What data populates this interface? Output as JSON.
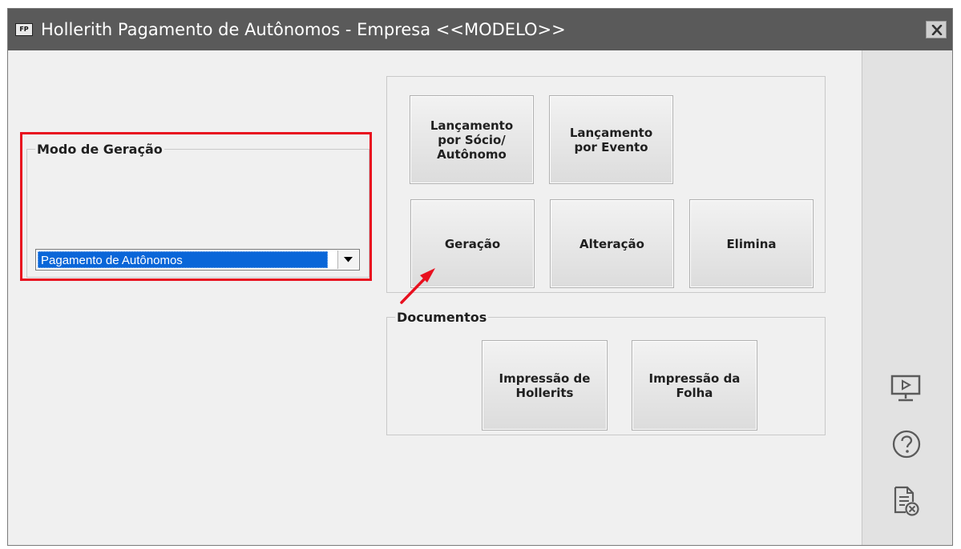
{
  "window": {
    "title": "Hollerith Pagamento de Autônomos - Empresa <<MODELO>>",
    "app_icon_label": "FP"
  },
  "modo": {
    "legend": "Modo de Geração",
    "selected": "Pagamento de Autônomos"
  },
  "actions": {
    "lanc_socio": "Lançamento\npor Sócio/\nAutônomo",
    "lanc_evento": "Lançamento\npor Evento",
    "geracao": "Geração",
    "alteracao": "Alteração",
    "elimina": "Elimina"
  },
  "documentos": {
    "legend": "Documentos",
    "imp_hollerits": "Impressão de\nHollerits",
    "imp_folha": "Impressão da\nFolha"
  },
  "colors": {
    "titlebar": "#5a5a5a",
    "highlight": "#e8101f",
    "selection": "#0a66d8"
  },
  "icons": [
    "presentation-icon",
    "help-icon",
    "document-close-icon"
  ]
}
